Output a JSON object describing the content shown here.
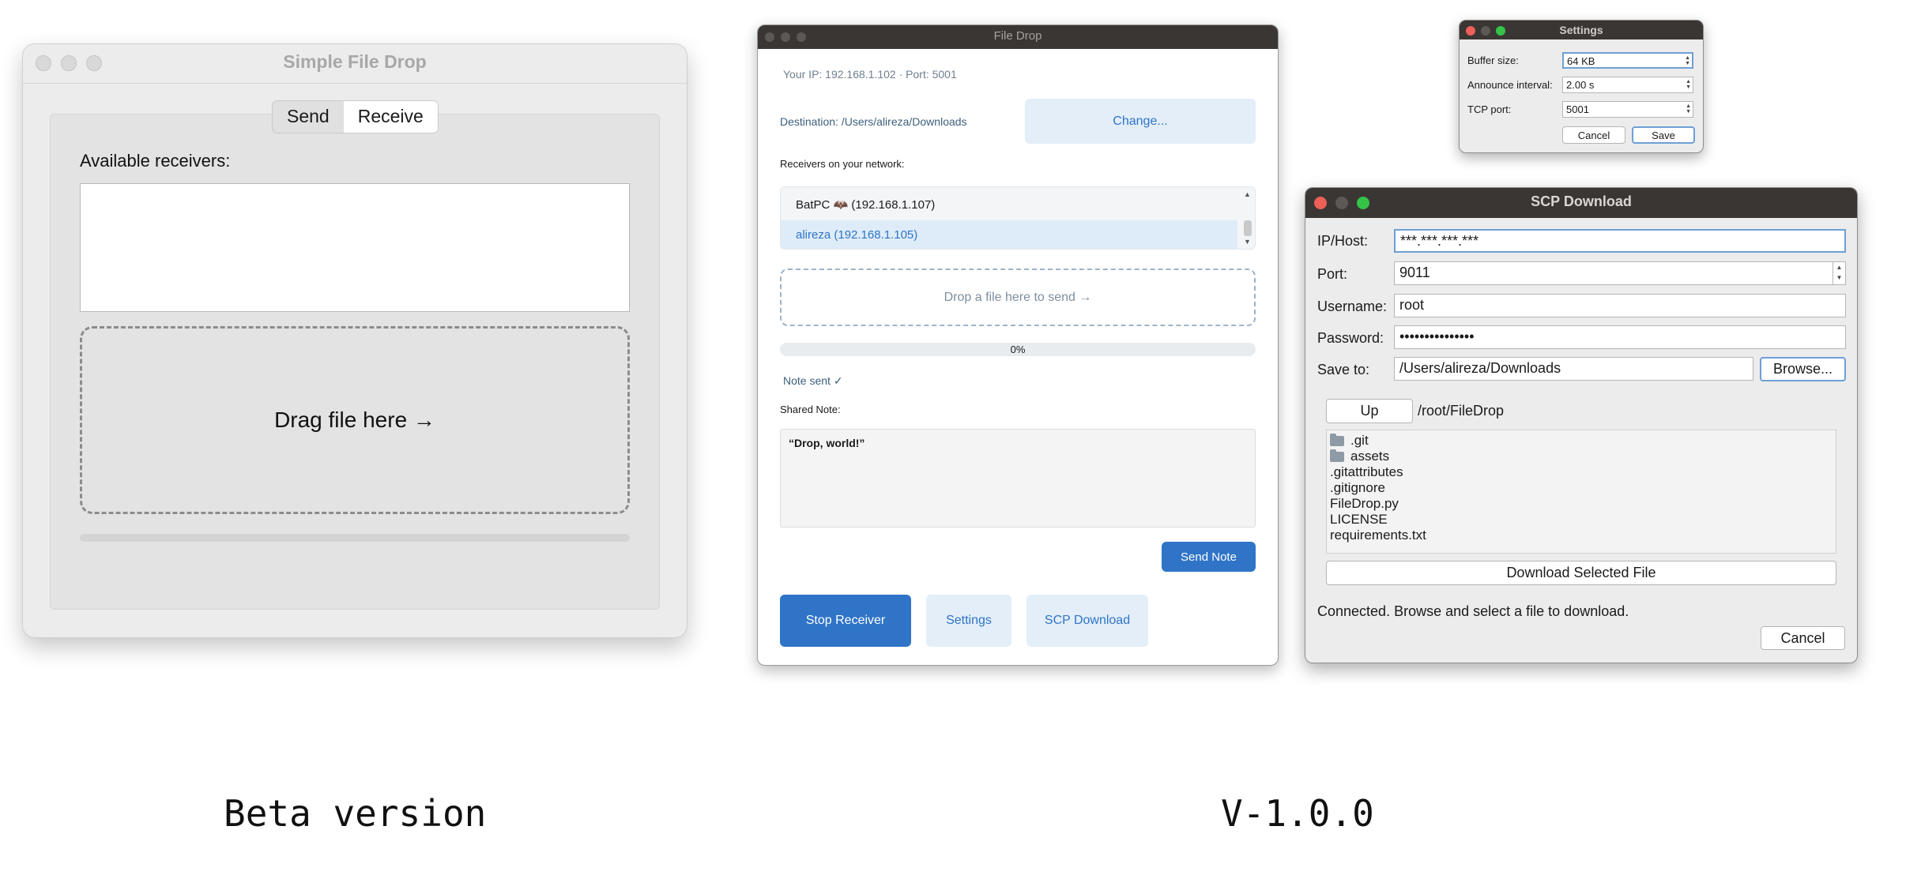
{
  "beta": {
    "window_title": "Simple File Drop",
    "tabs": [
      "Send",
      "Receive"
    ],
    "selected_tab": "Receive",
    "available_label": "Available receivers:",
    "drop_text": "Drag file here →",
    "caption": "Beta version"
  },
  "v1": {
    "window_title": "File Drop",
    "ip_line": "Your IP: 192.168.1.102  ·  Port: 5001",
    "destination": "Destination: /Users/alireza/Downloads",
    "change_button": "Change...",
    "receivers_label": "Receivers on your network:",
    "receivers": [
      "BatPC 🦇 (192.168.1.107)",
      "alireza (192.168.1.105)"
    ],
    "drop_text": "Drop a file here to send →",
    "progress": {
      "label": "0%",
      "value": 0
    },
    "note_status": "Note sent ✓",
    "shared_note_label": "Shared Note:",
    "shared_note_text": "“Drop, world!”",
    "send_note_button": "Send Note",
    "stop_button": "Stop Receiver",
    "settings_button": "Settings",
    "scp_button": "SCP Download",
    "caption": "V-1.0.0",
    "colors": {
      "accent": "#2f74c7",
      "accent_light": "#e3eef9"
    }
  },
  "settings": {
    "title": "Settings",
    "buffer_label": "Buffer size:",
    "buffer_value": "64 KB",
    "announce_label": "Announce interval:",
    "announce_value": "2.00 s",
    "tcp_label": "TCP port:",
    "tcp_value": "5001",
    "cancel_button": "Cancel",
    "save_button": "Save"
  },
  "scp": {
    "title": "SCP Download",
    "host_label": "IP/Host:",
    "host_value": "***.***.***.***",
    "port_label": "Port:",
    "port_value": "9011",
    "username_label": "Username:",
    "username_value": "root",
    "password_label": "Password:",
    "password_value": "•••••••••••••••",
    "saveto_label": "Save to:",
    "saveto_value": "/Users/alireza/Downloads",
    "browse_button": "Browse...",
    "up_button": "Up",
    "remote_path": "/root/FileDrop",
    "files": [
      {
        "name": ".git",
        "is_dir": true
      },
      {
        "name": "assets",
        "is_dir": true
      },
      {
        "name": ".gitattributes",
        "is_dir": false
      },
      {
        "name": ".gitignore",
        "is_dir": false
      },
      {
        "name": "FileDrop.py",
        "is_dir": false
      },
      {
        "name": "LICENSE",
        "is_dir": false
      },
      {
        "name": "requirements.txt",
        "is_dir": false
      }
    ],
    "download_button": "Download Selected File",
    "status": "Connected. Browse and select a file to download.",
    "cancel_button": "Cancel"
  }
}
